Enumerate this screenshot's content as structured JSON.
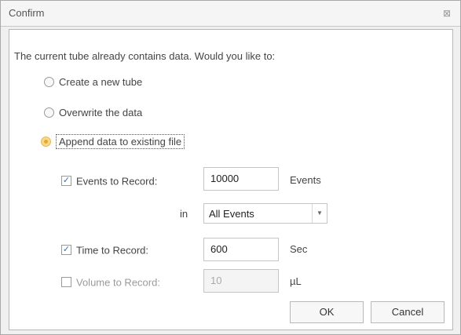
{
  "dialog": {
    "title": "Confirm",
    "close_icon": "close-icon",
    "question": "The current tube already contains data. Would you like to:",
    "options": [
      {
        "label": "Create a new tube",
        "selected": false
      },
      {
        "label": "Overwrite the data",
        "selected": false
      },
      {
        "label": "Append data to existing file",
        "selected": true
      }
    ],
    "events_to_record": {
      "label": "Events to Record:",
      "checked": true,
      "value": "10000",
      "unit": "Events"
    },
    "in_label": "in",
    "population": {
      "selected": "All Events"
    },
    "time_to_record": {
      "label": "Time to Record:",
      "checked": true,
      "value": "600",
      "unit": "Sec"
    },
    "volume_to_record": {
      "label": "Volume to Record:",
      "checked": false,
      "value": "10",
      "unit": "µL"
    },
    "buttons": {
      "ok": "OK",
      "cancel": "Cancel"
    }
  }
}
